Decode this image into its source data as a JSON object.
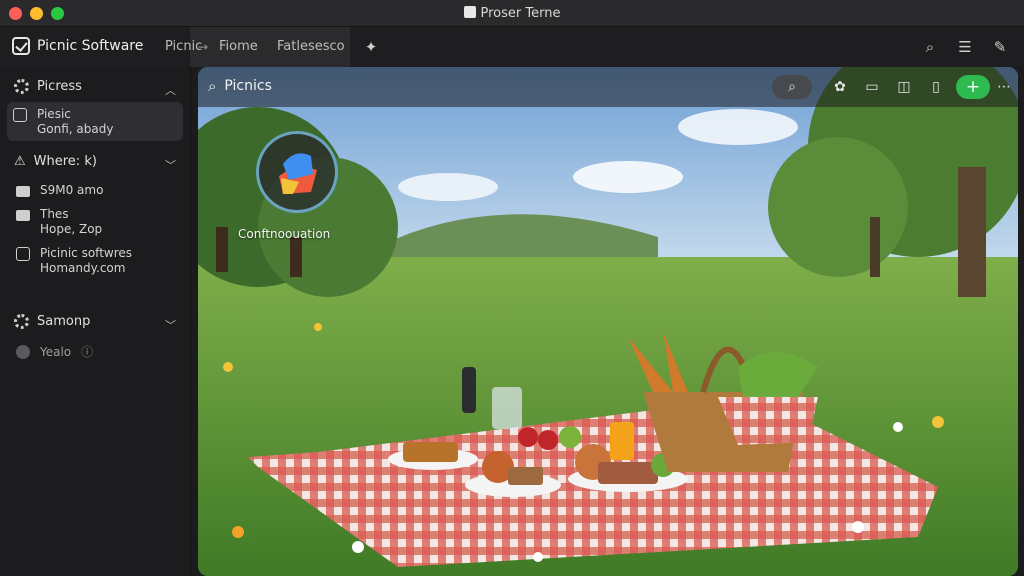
{
  "window": {
    "title": "Proser Terne"
  },
  "toolbar": {
    "brand": "Picnic Software",
    "tabs": [
      {
        "label": "Picnic"
      },
      {
        "label": "Fiome"
      },
      {
        "label": "Fatlesesco"
      }
    ]
  },
  "sidebar": {
    "section1": {
      "label": "Picress"
    },
    "card": {
      "line1": "Piesic",
      "line2": "Gonfi, abady"
    },
    "section2": {
      "label": "Where: k)"
    },
    "items": [
      {
        "line1": "S9M0 amo"
      },
      {
        "line1": "Thes",
        "line2": "Hope, Zop"
      },
      {
        "line1": "Picinic softwres",
        "line2": "Homandy.com"
      }
    ],
    "section3": {
      "label": "Samonp"
    },
    "footer": {
      "label": "Yealo"
    }
  },
  "content": {
    "title": "Picnics",
    "badge_label": "Conftnoouation"
  },
  "colors": {
    "accent_green": "#2dbb4f",
    "badge_ring": "#7fbfe6",
    "blanket_red": "#c8443c"
  }
}
